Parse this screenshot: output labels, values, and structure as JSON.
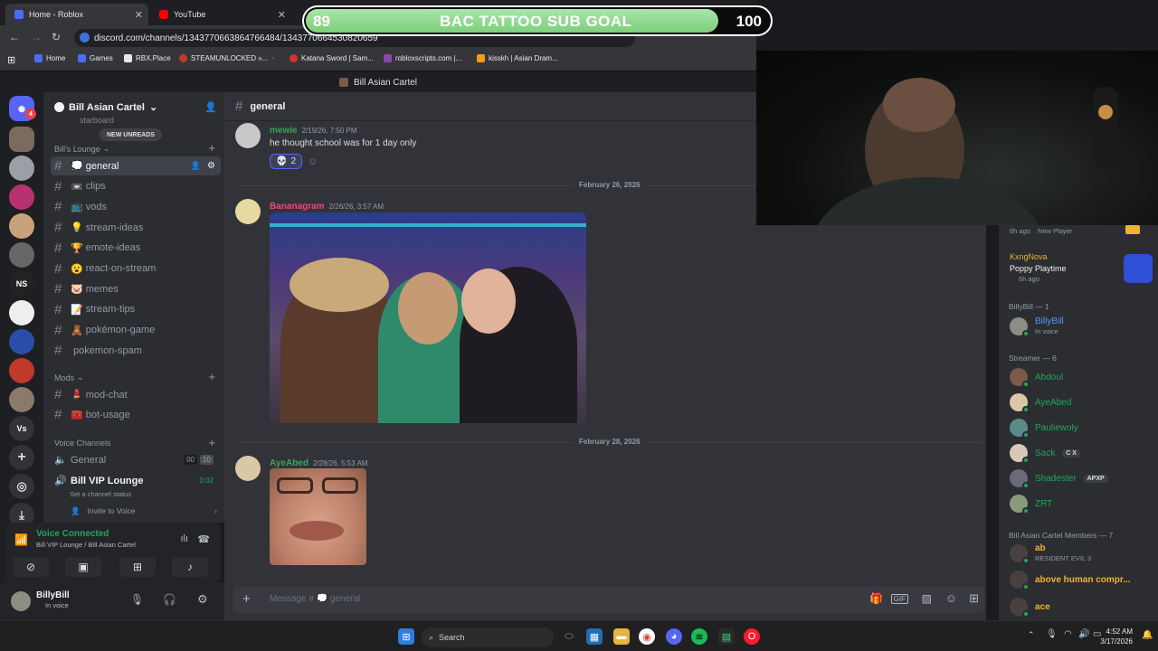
{
  "browser": {
    "tabs": [
      {
        "label": "Home - Roblox",
        "color": "#4a6cf7"
      },
      {
        "label": "YouTube",
        "color": "#ff0000"
      }
    ],
    "url": "discord.com/channels/1343770663864766484/1343770664530820659",
    "bookmarks": [
      "Home",
      "Games",
      "RBX.Place",
      "STEAMUNLOCKED »...",
      "Katana Sword | Sam...",
      "robloxscripts.com |...",
      "kisskh | Asian Dram..."
    ]
  },
  "overlay": {
    "goal_current": "89",
    "goal_title": "BAC TATTOO SUB GOAL",
    "goal_target": "100",
    "progress_fraction": 0.89
  },
  "discord": {
    "window_title": "Bill Asian Cartel",
    "rail_badge": "4",
    "rail_labels": {
      "ns": "NS",
      "vs": "Vs"
    },
    "server_name": "Bill Asian Cartel",
    "starboard": "starboard",
    "new_unreads": "NEW UNREADS",
    "categories": {
      "lounge": "Bill's Lounge",
      "mods": "Mods",
      "voice": "Voice Channels"
    },
    "channels": [
      {
        "name": "general",
        "emoji": "💭",
        "selected": true
      },
      {
        "name": "clips",
        "emoji": "📼"
      },
      {
        "name": "vods",
        "emoji": "📺"
      },
      {
        "name": "stream-ideas",
        "emoji": "💡"
      },
      {
        "name": "emote-ideas",
        "emoji": "🏆"
      },
      {
        "name": "react-on-stream",
        "emoji": "😮"
      },
      {
        "name": "memes",
        "emoji": "🐷"
      },
      {
        "name": "stream-tips",
        "emoji": "📝"
      },
      {
        "name": "pokémon-game",
        "emoji": "🧸"
      },
      {
        "name": "pokemon-spam",
        "emoji": ""
      }
    ],
    "mod_channels": [
      {
        "name": "mod-chat",
        "emoji": "💄"
      },
      {
        "name": "bot-usage",
        "emoji": "🧰"
      }
    ],
    "voice_channels": {
      "general": "General",
      "general_badges": [
        "00",
        "10"
      ],
      "vip": "Bill VIP Lounge",
      "vip_time": "0:02",
      "vip_status": "Set a channel status",
      "invite": "Invite to Voice"
    },
    "voice_panel": {
      "title": "Voice Connected",
      "subtitle": "Bill VIP Lounge / Bill Asian Cartel"
    },
    "user": {
      "name": "BillyBill",
      "status": "In voice"
    },
    "chat_header": "general",
    "messages": [
      {
        "author": "mewie",
        "time": "2/19/26, 7:50 PM",
        "text": "he thought school was for 1 day only",
        "reaction": "💀",
        "reaction_count": "2",
        "color": "#3ba55c"
      },
      {
        "author": "Bananagram",
        "time": "2/26/26, 3:57 AM",
        "color": "#e9488b"
      },
      {
        "author": "AyeAbed",
        "time": "2/28/26, 5:53 AM",
        "color": "#3ba55c"
      }
    ],
    "date_dividers": [
      "February 26, 2026",
      "February 28, 2026"
    ],
    "compose_placeholder": "Message # 💭 general"
  },
  "members": {
    "activity_top": {
      "time": "6h ago",
      "label": "New Player"
    },
    "kxng": {
      "name": "KxngNova",
      "game": "Poppy Playtime",
      "time": "6h ago"
    },
    "groups": {
      "billybill": "BillyBill — 1",
      "streamer": "Streamer — 6",
      "members": "Bill Asian Cartel Members — 7"
    },
    "billybill": {
      "name": "BillyBill",
      "status": "In voice"
    },
    "streamers": [
      {
        "name": "Abdoul",
        "tag": ""
      },
      {
        "name": "AyeAbed",
        "tag": ""
      },
      {
        "name": "Pauliewoly",
        "tag": ""
      },
      {
        "name": "Sack",
        "tag": "C X"
      },
      {
        "name": "Shadester",
        "tag": "APXP"
      },
      {
        "name": "ZRT",
        "tag": ""
      }
    ],
    "cartel": [
      {
        "name": "ab",
        "status": "RESIDENT EVIL 3",
        "color": "#f0b232"
      },
      {
        "name": "above human compr...",
        "status": "",
        "color": "#f0b232"
      },
      {
        "name": "ace",
        "status": "",
        "color": "#f0b232"
      }
    ]
  },
  "taskbar": {
    "search": "Search",
    "time": "4:52 AM",
    "date": "3/17/2026"
  }
}
